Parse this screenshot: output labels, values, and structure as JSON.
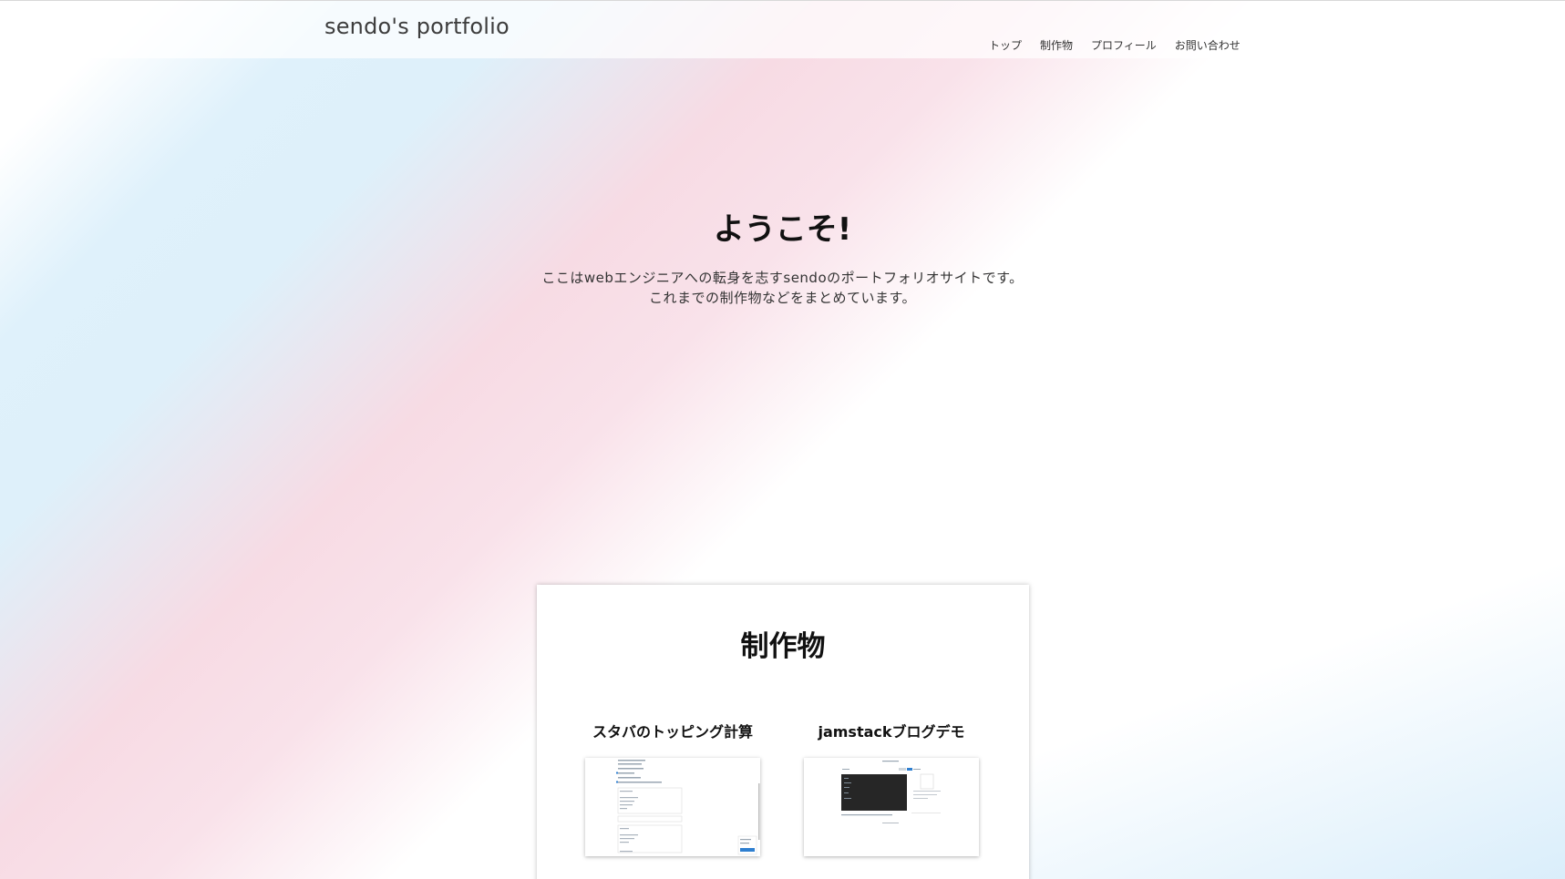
{
  "header": {
    "site_title": "sendo's portfolio",
    "nav": [
      {
        "label": "トップ"
      },
      {
        "label": "制作物"
      },
      {
        "label": "プロフィール"
      },
      {
        "label": "お問い合わせ"
      }
    ]
  },
  "hero": {
    "heading": "ようこそ!",
    "description_line1": "ここはwebエンジニアへの転身を志すsendoのポートフォリオサイトです。",
    "description_line2": "これまでの制作物などをまとめています。"
  },
  "works": {
    "heading": "制作物",
    "items": [
      {
        "title": "スタバのトッピング計算"
      },
      {
        "title": "jamstackブログデモ"
      }
    ]
  },
  "colors": {
    "gradient_blue": "#dff1fb",
    "gradient_pink": "#f7dbe4",
    "heading_text": "#111111",
    "body_text": "#333333"
  }
}
